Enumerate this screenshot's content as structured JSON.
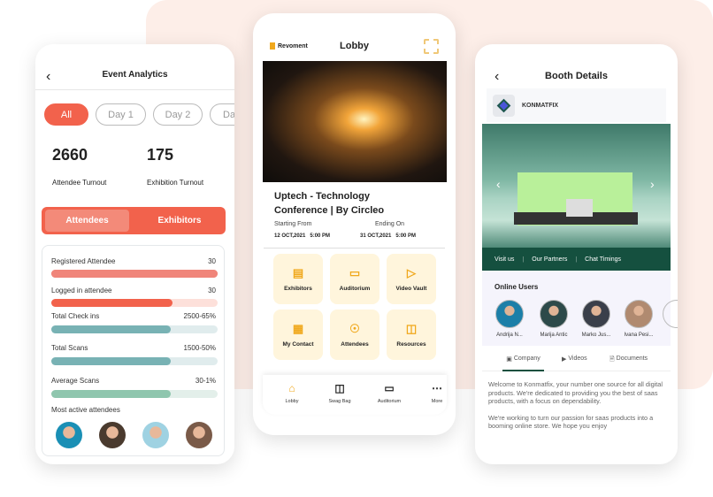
{
  "analytics": {
    "title": "Event Analytics",
    "chips": [
      "All",
      "Day 1",
      "Day 2",
      "Da"
    ],
    "stats": [
      {
        "value": "2660",
        "label": "Attendee Turnout"
      },
      {
        "value": "175",
        "label": "Exhibition Turnout"
      }
    ],
    "tabs": [
      "Attendees",
      "Exhibitors"
    ],
    "rows": [
      {
        "label": "Registered Attendee",
        "value": "30",
        "fill": 1.0,
        "color": "#f0857a",
        "track": "#f0857a"
      },
      {
        "label": "Logged in attendee",
        "value": "30",
        "fill": 0.73,
        "color": "#f2624c",
        "track": "#fde0da"
      },
      {
        "label": "Total Check ins",
        "value": "2500-65%",
        "fill": 0.72,
        "color": "#78b2b4",
        "track": "#e0eced"
      },
      {
        "label": "Total Scans",
        "value": "1500-50%",
        "fill": 0.72,
        "color": "#78b2b4",
        "track": "#e0eced"
      },
      {
        "label": "Average Scans",
        "value": "30-1%",
        "fill": 0.72,
        "color": "#8fc6ae",
        "track": "#e3efea"
      }
    ],
    "most_active_label": "Most active attendees"
  },
  "lobby": {
    "brand": "Revoment",
    "title": "Lobby",
    "event_title_1": "Uptech - Technology",
    "event_title_2": "Conference | By Circleo",
    "start_label": "Starting From",
    "start_date": "12 OCT,2021",
    "start_time": "5:00 PM",
    "end_label": "Ending On",
    "end_date": "31 OCT,2021",
    "end_time": "5:00 PM",
    "tiles": [
      {
        "label": "Exhibitors",
        "icon": "store-icon"
      },
      {
        "label": "Auditorium",
        "icon": "laptop-icon"
      },
      {
        "label": "Video Vault",
        "icon": "video-icon"
      },
      {
        "label": "My Contact",
        "icon": "contact-card-icon"
      },
      {
        "label": "Attendees",
        "icon": "user-circle-icon"
      },
      {
        "label": "Resources",
        "icon": "bag-icon"
      }
    ],
    "nav": [
      {
        "label": "Lobby",
        "icon": "home-icon",
        "active": true
      },
      {
        "label": "Swag Bag",
        "icon": "bag-icon"
      },
      {
        "label": "Auditorium",
        "icon": "laptop-icon"
      },
      {
        "label": "More",
        "icon": "more-icon"
      }
    ],
    "accent": "#f0a81c"
  },
  "booth": {
    "title": "Booth Details",
    "company": "KONMATFIX",
    "links": [
      "Visit us",
      "Our Partners",
      "Chat Timings"
    ],
    "online_title": "Online Users",
    "users": [
      "Andrija N...",
      "Marija Antic",
      "Marko Jus...",
      "Ivana Pesi..."
    ],
    "tabs": [
      "Company",
      "Videos",
      "Documents"
    ],
    "para1": "Welcome to Konmatfix, your number one source for all digital products. We're dedicated to providing you the best of saas products, with a focus on dependability.",
    "para2": "We're working to turn our passion for saas products into a booming online store. We hope you enjoy",
    "accent": "#15503f"
  }
}
